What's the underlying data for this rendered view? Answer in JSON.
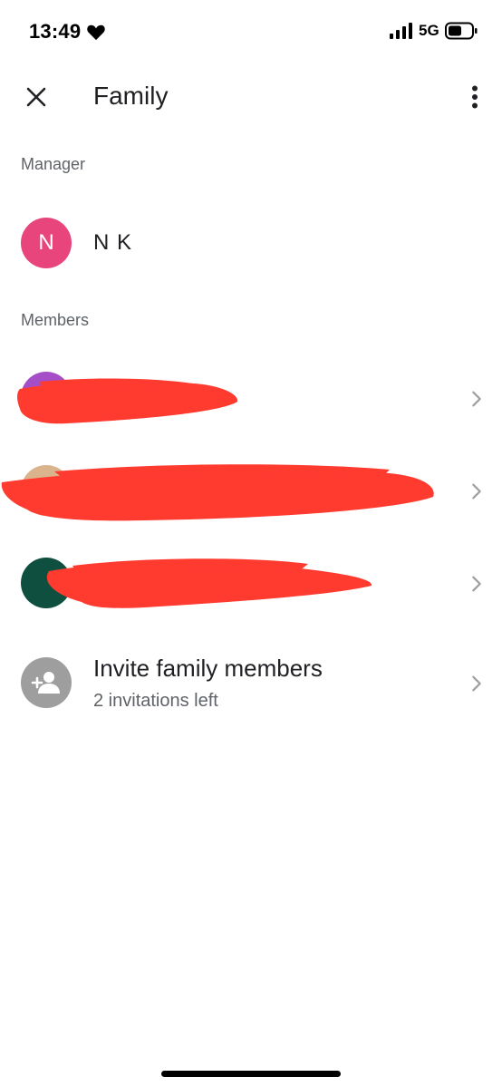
{
  "status_bar": {
    "time": "13:49",
    "network": "5G",
    "icons": [
      "heart-icon",
      "signal-bars-icon",
      "battery-icon"
    ]
  },
  "app_bar": {
    "title": "Family",
    "close_icon": "close-icon",
    "more_icon": "more-vert-icon"
  },
  "manager_section": {
    "label": "Manager",
    "manager": {
      "initial": "N",
      "name": "N K",
      "avatar_color": "#e8457c"
    }
  },
  "members_section": {
    "label": "Members",
    "members": [
      {
        "avatar_color": "#a64dc8",
        "redacted": true
      },
      {
        "avatar_color": "#d9b48c",
        "redacted": true
      },
      {
        "avatar_color": "#0f4f3f",
        "redacted": true
      }
    ]
  },
  "invite": {
    "title": "Invite family members",
    "subtitle": "2 invitations left",
    "icon": "add-person-icon",
    "icon_bg": "#9e9e9e"
  },
  "colors": {
    "redaction": "#ff3b30",
    "text_primary": "#202124",
    "text_secondary": "#5f6368",
    "chevron": "#9e9e9e"
  }
}
